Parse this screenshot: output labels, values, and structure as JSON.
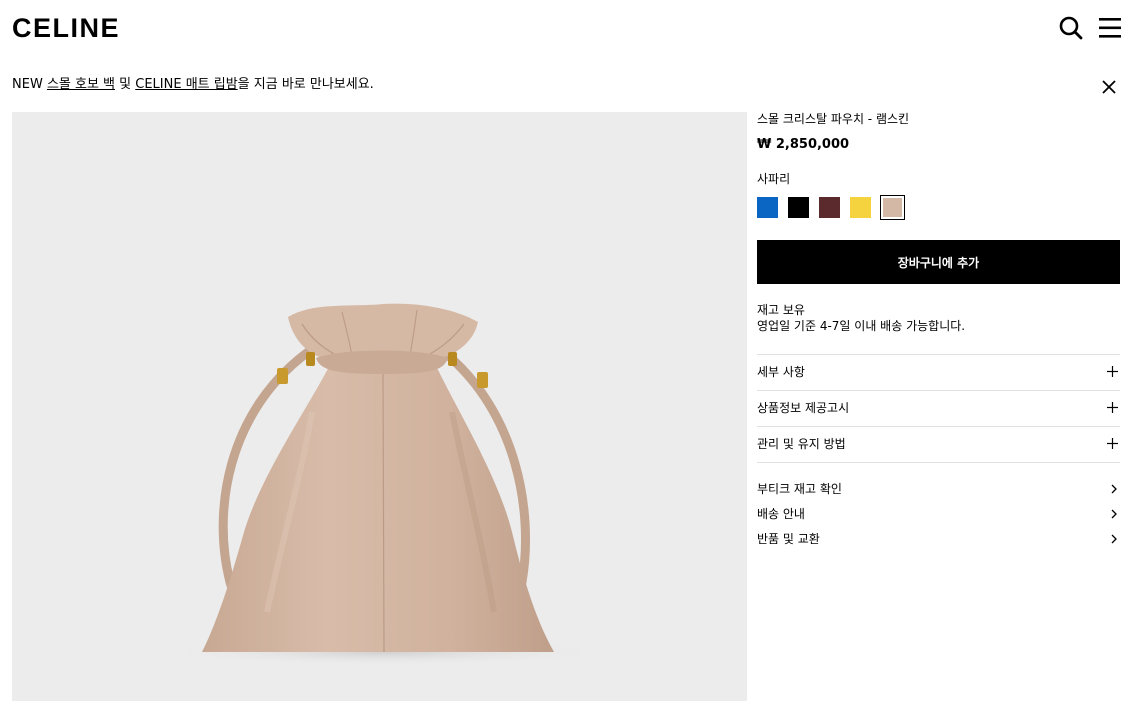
{
  "header": {
    "logo": "CELINE",
    "search_icon": "search-icon",
    "menu_icon": "hamburger-menu-icon"
  },
  "banner": {
    "prefix": "NEW ",
    "link1": "스몰 호보 백",
    "middle": " 및 ",
    "link2": "CELINE 매트 립밤",
    "suffix": "을 지금 바로 만나보세요.",
    "close_icon": "close-icon"
  },
  "product": {
    "name": "스몰 크리스탈 파우치 - 램스킨",
    "price": "₩ 2,850,000",
    "color_name": "사파리",
    "swatches": [
      {
        "name": "blue",
        "color": "#0a66c2"
      },
      {
        "name": "black",
        "color": "#000000"
      },
      {
        "name": "burgundy",
        "color": "#5a2a2d"
      },
      {
        "name": "yellow",
        "color": "#f5d33f"
      },
      {
        "name": "safari",
        "color": "#d4b8a6",
        "selected": true
      }
    ],
    "image_bg": "#ececec",
    "leather_color": "#d2b5a1"
  },
  "cart": {
    "add_label": "장바구니에 추가"
  },
  "availability": {
    "stock": "재고 보유",
    "delivery": "영업일 기준 4-7일 이내 배송 가능합니다."
  },
  "accordion": [
    {
      "label": "세부 사항",
      "icon": "plus-icon"
    },
    {
      "label": "상품정보 제공고시",
      "icon": "plus-icon"
    },
    {
      "label": "관리 및 유지 방법",
      "icon": "plus-icon"
    }
  ],
  "links": [
    {
      "label": "부티크 재고 확인",
      "icon": "chevron-right-icon"
    },
    {
      "label": "배송 안내",
      "icon": "chevron-right-icon"
    },
    {
      "label": "반품 및 교환",
      "icon": "chevron-right-icon"
    }
  ]
}
